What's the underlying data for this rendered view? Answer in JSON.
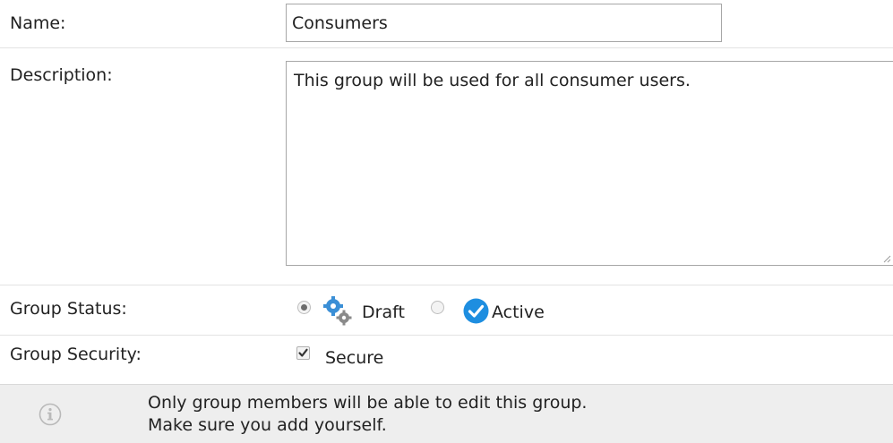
{
  "form": {
    "name": {
      "label": "Name:",
      "value": "Consumers"
    },
    "description": {
      "label": "Description:",
      "value": "This group will be used for all consumer users."
    },
    "status": {
      "label": "Group Status:",
      "options": [
        {
          "label": "Draft",
          "selected": true,
          "icon": "gears-icon"
        },
        {
          "label": "Active",
          "selected": false,
          "icon": "checkmark-circle-icon"
        }
      ]
    },
    "security": {
      "label": "Group Security:",
      "option_label": "Secure",
      "checked": true
    }
  },
  "notice": {
    "icon": "info-icon",
    "line1": "Only group members will be able to edit this group.",
    "line2": "Make sure you add yourself."
  },
  "colors": {
    "active_blue": "#1e8ee0",
    "gear_blue": "#3b8fd6",
    "gear_gray": "#8a8a8a",
    "notice_bg": "#eeeeee"
  }
}
